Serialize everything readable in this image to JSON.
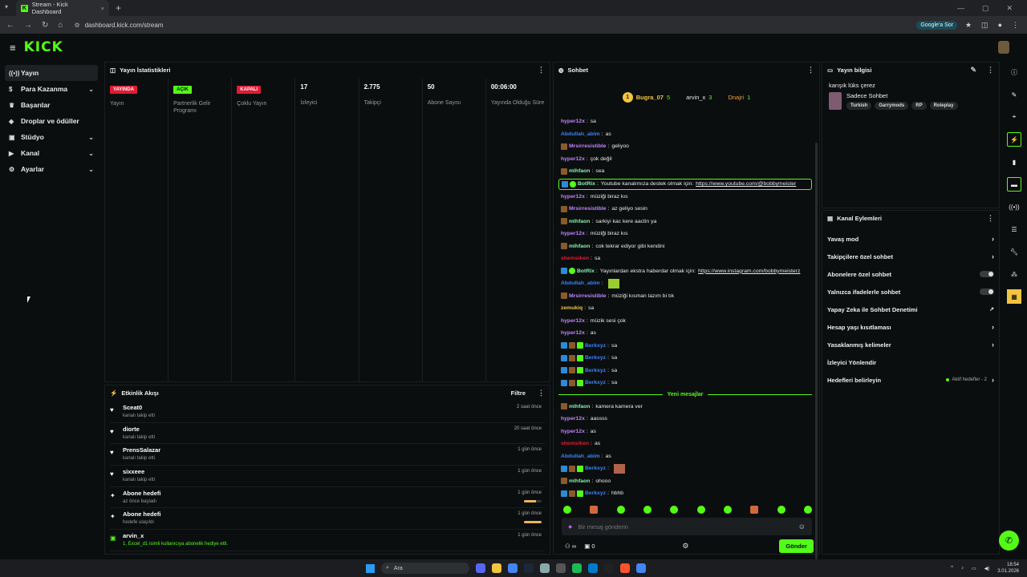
{
  "browser": {
    "tab_title": "Stream - Kick Dashboard",
    "url": "dashboard.kick.com/stream",
    "google_button": "Google'a Sor"
  },
  "sidebar": {
    "items": [
      {
        "label": "Yayın",
        "icon": "broadcast-icon",
        "active": true
      },
      {
        "label": "Para Kazanma",
        "icon": "money-icon",
        "chevron": true
      },
      {
        "label": "Başarılar",
        "icon": "trophy-icon"
      },
      {
        "label": "Droplar ve ödüller",
        "icon": "gift-icon"
      },
      {
        "label": "Stüdyo",
        "icon": "studio-icon",
        "chevron": true
      },
      {
        "label": "Kanal",
        "icon": "channel-icon",
        "chevron": true
      },
      {
        "label": "Ayarlar",
        "icon": "gear-icon",
        "chevron": true
      }
    ]
  },
  "stats": {
    "title": "Yayın İstatistikleri",
    "columns": [
      {
        "pill": "YAYINDA",
        "pill_color": "#e21b33",
        "value": "",
        "label": "Yayın"
      },
      {
        "pill": "AÇIK",
        "pill_color": "#53fc18",
        "value": "",
        "label": "Partnerlik Gelir Programı"
      },
      {
        "pill": "KAPALI",
        "pill_color": "#e21b33",
        "value": "",
        "label": "Çoklu Yayın"
      },
      {
        "pill": "",
        "value": "17",
        "label": "İzleyici"
      },
      {
        "pill": "",
        "value": "2.775",
        "label": "Takipçi"
      },
      {
        "pill": "",
        "value": "50",
        "label": "Abone Sayısı"
      },
      {
        "pill": "",
        "value": "00:06:00",
        "label": "Yayında Olduğu Süre"
      }
    ]
  },
  "activity": {
    "title": "Etkinlik Akışı",
    "filter_label": "Filtre",
    "items": [
      {
        "icon": "heart-icon",
        "name": "Sceat0",
        "sub": "kanalı takip etti",
        "time": "2 saat önce"
      },
      {
        "icon": "heart-icon",
        "name": "diorte",
        "sub": "kanalı takip etti",
        "time": "20 saat önce"
      },
      {
        "icon": "heart-icon",
        "name": "PrensSalazar",
        "sub": "kanalı takip etti",
        "time": "1 gün önce"
      },
      {
        "icon": "heart-icon",
        "name": "sixxeee",
        "sub": "kanalı takip etti",
        "time": "1 gün önce"
      },
      {
        "icon": "sparkle-icon",
        "name": "Abone hedefi",
        "sub": "az önce başladı",
        "time": "1 gün önce",
        "progress": 0.7
      },
      {
        "icon": "sparkle-icon",
        "name": "Abone hedefi",
        "sub": "hedefe ulaşıldı",
        "time": "1 gün önce",
        "progress": 1.0
      },
      {
        "icon": "gift-icon",
        "name": "arvin_x",
        "sub": "1, Excel_d1 isimli kullanıcıya abonelik hediye etti.",
        "sub_green": true,
        "time": "1 gün önce"
      }
    ]
  },
  "chat": {
    "title": "Sohbet",
    "top_users": [
      {
        "name": "Bugra_07",
        "count": "5"
      },
      {
        "name": "arvin_x",
        "count": "3"
      },
      {
        "name": "Dnajri",
        "count": "1"
      }
    ],
    "messages": [
      {
        "user": "hyper12x",
        "color": "#c084fc",
        "text": "sa"
      },
      {
        "user": "Abdullah_abim",
        "color": "#3b82f6",
        "text": "as"
      },
      {
        "user": "Mrsirresistible",
        "color": "#c084fc",
        "text": "geliyoo",
        "badges": [
          "b-brown"
        ]
      },
      {
        "user": "hyper12x",
        "color": "#c084fc",
        "text": "çok değil"
      },
      {
        "user": "mlhfaon",
        "color": "#86efac",
        "text": "sea",
        "badges": [
          "b-brown"
        ]
      },
      {
        "user": "BotRix",
        "color": "#86efac",
        "text": "Youtube kanalımıza destek olmak için:",
        "link": "https://www.youtube.com/@bobbymeister",
        "bot": true,
        "badges": [
          "b-blue",
          "b-green"
        ]
      },
      {
        "user": "hyper12x",
        "color": "#c084fc",
        "text": "müziği biraz kıs"
      },
      {
        "user": "Mrsirresistible",
        "color": "#c084fc",
        "text": "az geliyo sesin",
        "badges": [
          "b-brown"
        ]
      },
      {
        "user": "mlhfaon",
        "color": "#86efac",
        "text": "sarkiyi kac kere aactin ya",
        "badges": [
          "b-brown"
        ]
      },
      {
        "user": "hyper12x",
        "color": "#c084fc",
        "text": "müziği biraz kıs"
      },
      {
        "user": "mlhfaon",
        "color": "#86efac",
        "text": "cok tekrar ediyor gibi kendini",
        "badges": [
          "b-brown"
        ]
      },
      {
        "user": "shemsiken",
        "color": "#e21b33",
        "text": "sa"
      },
      {
        "user": "BotRix",
        "color": "#86efac",
        "text": "Yayınlardan ekstra haberdar olmak için:",
        "link": "https://www.instagram.com/bobbymeisterz",
        "badges": [
          "b-blue",
          "b-green"
        ]
      },
      {
        "user": "Abdullah_abim",
        "color": "#3b82f6",
        "text": "",
        "emote": "green"
      },
      {
        "user": "Mrsirresistible",
        "color": "#c084fc",
        "text": "müziği kısman lazım bi tık",
        "badges": [
          "b-brown"
        ]
      },
      {
        "user": "zemukiq",
        "color": "#f2c440",
        "text": "sa"
      },
      {
        "user": "hyper12x",
        "color": "#c084fc",
        "text": "müzik sesi çok"
      },
      {
        "user": "hyper12x",
        "color": "#c084fc",
        "text": "as"
      },
      {
        "user": "Berkxyz",
        "color": "#3b82f6",
        "text": "sa",
        "badges": [
          "b-blue",
          "b-brown",
          "b-sub"
        ]
      },
      {
        "user": "Berkxyz",
        "color": "#3b82f6",
        "text": "sa",
        "badges": [
          "b-blue",
          "b-brown",
          "b-sub"
        ]
      },
      {
        "user": "Berkxyz",
        "color": "#3b82f6",
        "text": "sa",
        "badges": [
          "b-blue",
          "b-brown",
          "b-sub"
        ]
      },
      {
        "user": "Berkxyz",
        "color": "#3b82f6",
        "text": "sa",
        "badges": [
          "b-blue",
          "b-brown",
          "b-sub"
        ]
      }
    ],
    "new_messages_label": "Yeni mesajlar",
    "new_messages": [
      {
        "user": "mlhfaon",
        "color": "#86efac",
        "text": "kamera kamera ver",
        "badges": [
          "b-brown"
        ]
      },
      {
        "user": "hyper12x",
        "color": "#c084fc",
        "text": "aassss"
      },
      {
        "user": "hyper12x",
        "color": "#c084fc",
        "text": "as"
      },
      {
        "user": "shemsiken",
        "color": "#e21b33",
        "text": "as"
      },
      {
        "user": "Abdullah_abim",
        "color": "#3b82f6",
        "text": "as"
      },
      {
        "user": "Berkxyz",
        "color": "#3b82f6",
        "text": "",
        "emote": "brown",
        "badges": [
          "b-blue",
          "b-brown",
          "b-sub"
        ]
      },
      {
        "user": "mlhfaon",
        "color": "#86efac",
        "text": "ohooo",
        "badges": [
          "b-brown"
        ]
      },
      {
        "user": "Berkxyz",
        "color": "#3b82f6",
        "text": "hbhb",
        "badges": [
          "b-blue",
          "b-brown",
          "b-sub"
        ]
      }
    ],
    "input_placeholder": "Bir mesaj gönderin",
    "infinity_label": "∞",
    "points": "0",
    "send_label": "Gönder"
  },
  "stream_info": {
    "title": "Yayın bilgisi",
    "stream_title": "karışık lüks çerez",
    "category": "Sadece Sohbet",
    "tags": [
      "Turkish",
      "Garrymods",
      "RP",
      "Roleplay"
    ]
  },
  "channel_actions": {
    "title": "Kanal Eylemleri",
    "items": [
      {
        "label": "Yavaş mod",
        "control": "arrow"
      },
      {
        "label": "Takipçilere özel sohbet",
        "control": "arrow"
      },
      {
        "label": "Abonelere özel sohbet",
        "control": "toggle"
      },
      {
        "label": "Yalnızca ifadelerle sohbet",
        "control": "toggle"
      },
      {
        "label": "Yapay Zeka ile Sohbet Denetimi",
        "control": "external"
      },
      {
        "label": "Hesap yaşı kısıtlaması",
        "control": "arrow"
      },
      {
        "label": "Yasaklanmış kelimeler",
        "control": "arrow"
      },
      {
        "label": "İzleyici Yönlendir",
        "control": "none"
      },
      {
        "label": "Hedefleri belirleyin",
        "control": "arrow",
        "note": "Aktif hedefler - 2"
      }
    ]
  },
  "taskbar": {
    "search_label": "Ara",
    "time": "18:54",
    "date": "3.01.2026"
  },
  "colors": {
    "accent": "#53fc18",
    "live_red": "#e21b33",
    "background": "#0b0e0f"
  }
}
